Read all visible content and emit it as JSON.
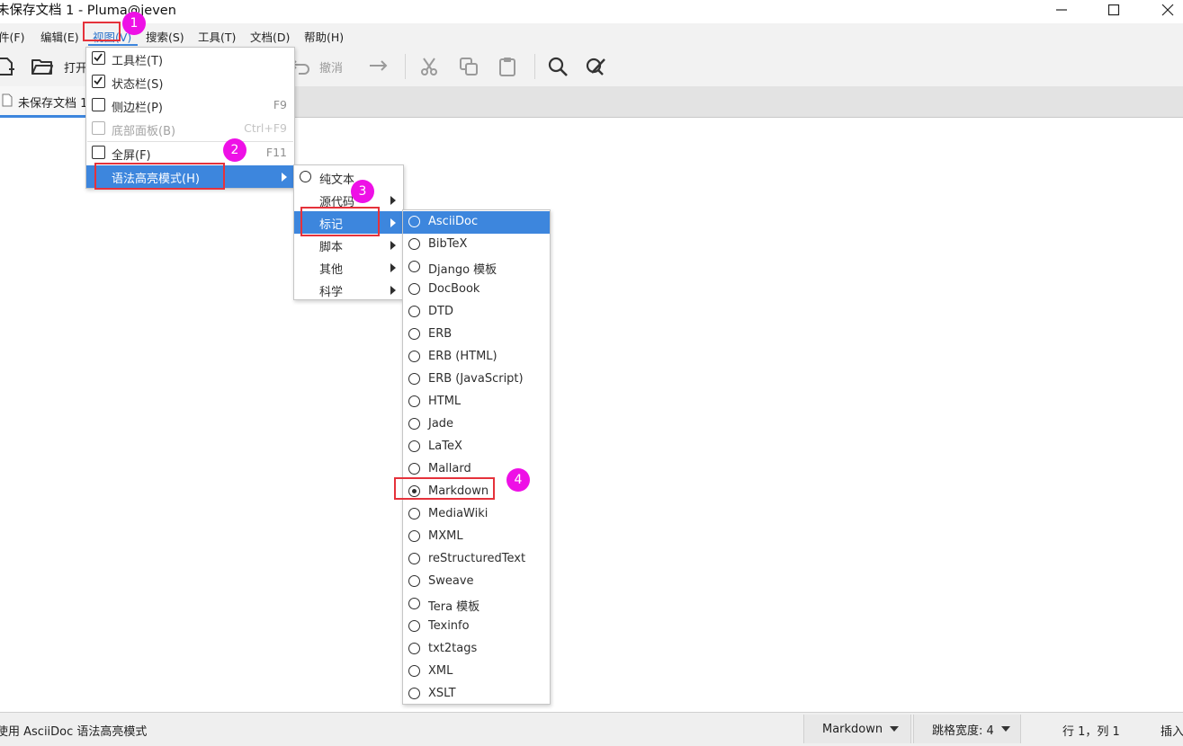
{
  "window": {
    "title": "未保存文档 1 - Pluma@jeven"
  },
  "menubar": {
    "items": [
      {
        "name": "menu-file",
        "label": "件(F)"
      },
      {
        "name": "menu-edit",
        "label": "编辑(E)"
      },
      {
        "name": "menu-view",
        "label": "视图(V)"
      },
      {
        "name": "menu-search",
        "label": "搜索(S)"
      },
      {
        "name": "menu-tools",
        "label": "工具(T)"
      },
      {
        "name": "menu-documents",
        "label": "文档(D)"
      },
      {
        "name": "menu-help",
        "label": "帮助(H)"
      }
    ]
  },
  "toolbar": {
    "open_label": "打开",
    "undo_label": "撤消",
    "icons": [
      "new-document-icon",
      "open-folder-icon",
      "undo-icon",
      "redo-icon",
      "cut-icon",
      "copy-icon",
      "paste-icon",
      "search-icon",
      "replace-icon"
    ]
  },
  "tab": {
    "label": "未保存文档 1"
  },
  "view_menu": {
    "items": [
      {
        "label": "工具栏(T)",
        "checked": true,
        "accel": ""
      },
      {
        "label": "状态栏(S)",
        "checked": true,
        "accel": ""
      },
      {
        "label": "侧边栏(P)",
        "checked": false,
        "accel": "F9"
      },
      {
        "label": "底部面板(B)",
        "checked": false,
        "accel": "Ctrl+F9",
        "disabled": true
      },
      {
        "label": "全屏(F)",
        "checked": false,
        "accel": "F11"
      },
      {
        "label": "语法高亮模式(H)",
        "submenu": true,
        "highlighted": true
      }
    ]
  },
  "highlight_menu": {
    "items": [
      {
        "label": "纯文本",
        "radio": true
      },
      {
        "label": "源代码",
        "submenu": true
      },
      {
        "label": "标记",
        "submenu": true,
        "highlighted": true
      },
      {
        "label": "脚本",
        "submenu": true
      },
      {
        "label": "其他",
        "submenu": true
      },
      {
        "label": "科学",
        "submenu": true
      }
    ]
  },
  "markup_menu": {
    "items": [
      "AsciiDoc",
      "BibTeX",
      "Django 模板",
      "DocBook",
      "DTD",
      "ERB",
      "ERB (HTML)",
      "ERB (JavaScript)",
      "HTML",
      "Jade",
      "LaTeX",
      "Mallard",
      "Markdown",
      "MediaWiki",
      "MXML",
      "reStructuredText",
      "Sweave",
      "Tera 模板",
      "Texinfo",
      "txt2tags",
      "XML",
      "XSLT"
    ],
    "highlighted": "AsciiDoc",
    "selected": "Markdown"
  },
  "annotations": {
    "badges": [
      "1",
      "2",
      "3",
      "4"
    ],
    "badge_color": "#ee10e6",
    "box_color": "#e5323b"
  },
  "statusbar": {
    "message": "使用 AsciiDoc 语法高亮模式",
    "language": "Markdown",
    "tab_width": "跳格宽度: 4",
    "position": "行 1，列 1",
    "mode": "插入"
  },
  "colors": {
    "accent": "#3d86dd",
    "menubar_bg": "#f2f2f2"
  }
}
